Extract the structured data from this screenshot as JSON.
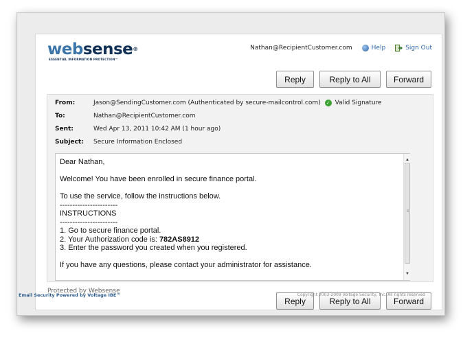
{
  "brand": {
    "name_part1": "web",
    "name_part2": "sense",
    "registered": "®",
    "tagline": "ESSENTIAL INFORMATION PROTECTION™"
  },
  "userbar": {
    "user_email": "Nathan@RecipientCustomer.com",
    "help_label": "Help",
    "signout_label": "Sign Out",
    "help_icon": "help-icon",
    "signout_icon": "sign-out-icon"
  },
  "actions": {
    "reply_label": "Reply",
    "reply_all_label": "Reply to All",
    "forward_label": "Forward"
  },
  "message": {
    "from_label": "From:",
    "from_value": "Jason@SendingCustomer.com (Authenticated by secure-mailcontrol.com)",
    "signature_status": "Valid Signature",
    "to_label": "To:",
    "to_value": "Nathan@RecipientCustomer.com",
    "sent_label": "Sent:",
    "sent_value": "Wed Apr 13, 2011 10:42 AM (1 hour ago)",
    "subject_label": "Subject:",
    "subject_value": "Secure Information Enclosed"
  },
  "body": {
    "greeting": "Dear Nathan,",
    "welcome": "Welcome! You have been enrolled in secure finance portal.",
    "instructions_intro": "To use the service, follow the instructions below.",
    "rule1": "-----------------------",
    "instructions_heading": "INSTRUCTIONS",
    "rule2": "-----------------------",
    "step1": "1. Go to secure finance portal.",
    "step2_prefix": "2. Your Authorization code is: ",
    "step2_code": "782AS8912",
    "step3": "3. Enter the password you created when you registered.",
    "closing": "If you have any questions, please contact your administrator for assistance."
  },
  "protected_by": "Protected by Websense",
  "footer": {
    "powered_by": "Email Security Powered by Voltage IBE™",
    "copyright": "Copyright 2003-2009 Voltage Security, Inc. All rights reserved"
  },
  "colors": {
    "brand_light": "#3a74a8",
    "brand_dark": "#0f2f55",
    "link": "#2b65a8",
    "valid": "#3aa232"
  }
}
